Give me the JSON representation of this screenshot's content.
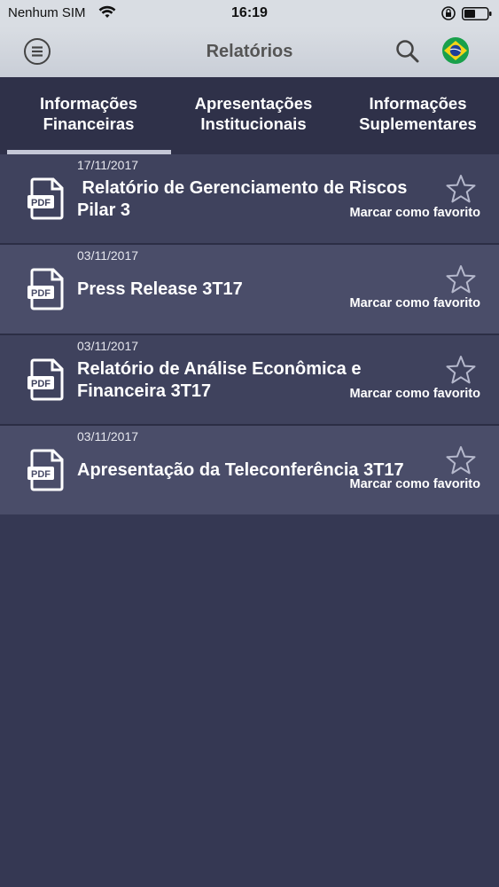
{
  "status_bar": {
    "carrier": "Nenhum SIM",
    "time": "16:19"
  },
  "nav": {
    "title": "Relatórios",
    "icons": [
      "menu-icon",
      "search-icon",
      "brazil-flag-icon"
    ]
  },
  "tabs": [
    {
      "label": "Informações\nFinanceiras",
      "active": true
    },
    {
      "label": "Apresentações\nInstitucionais",
      "active": false
    },
    {
      "label": "Informações\nSuplementares",
      "active": false
    }
  ],
  "reports": [
    {
      "date": "17/11/2017",
      "title": " Relatório de Gerenciamento de Riscos\nPilar 3",
      "favorite_label": "Marcar como favorito"
    },
    {
      "date": "03/11/2017",
      "title": "Press Release 3T17",
      "favorite_label": "Marcar como favorito"
    },
    {
      "date": "03/11/2017",
      "title": "Relatório de Análise Econômica e\nFinanceira 3T17",
      "favorite_label": "Marcar como favorito"
    },
    {
      "date": "03/11/2017",
      "title": "Apresentação da Teleconferência 3T17",
      "favorite_label": "Marcar como favorito"
    }
  ],
  "colors": {
    "background": "#353853",
    "row_dark": "#3f425d",
    "row_light": "#4a4d69",
    "tab_bar": "#2f3149",
    "nav_bar": "#d9dde3"
  }
}
